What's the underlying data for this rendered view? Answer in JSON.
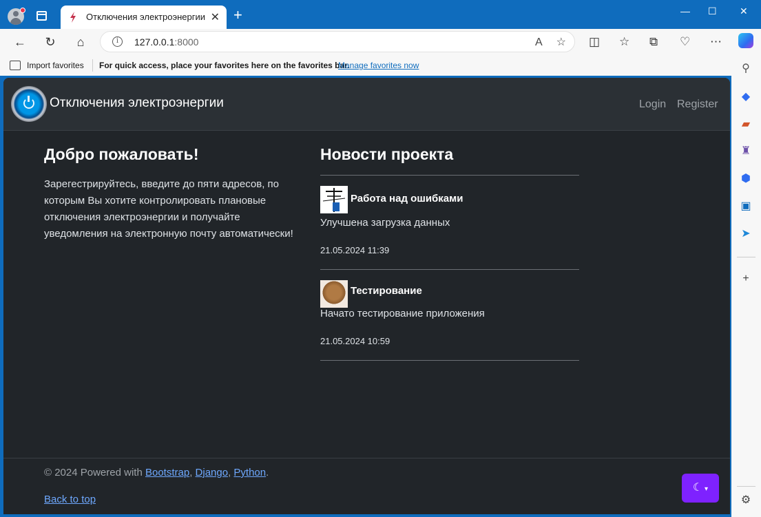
{
  "browser": {
    "tab_title": "Отключения электроэнергии",
    "tab_close": "✕",
    "new_tab": "+",
    "url_host": "127.0.0.1",
    "url_port": ":8000",
    "window_controls": {
      "minimize": "—",
      "maximize": "☐",
      "close": "✕"
    }
  },
  "favorites_bar": {
    "import_label": "Import favorites",
    "hint": "For quick access, place your favorites here on the favorites bar.",
    "manage_label": "Manage favorites now"
  },
  "site": {
    "brand": "Отключения электроэнергии",
    "nav": {
      "login": "Login",
      "register": "Register"
    },
    "welcome": {
      "title": "Добро пожаловать!",
      "text": "Зарегестрируйтесь, введите до пяти адресов, по которым Вы хотите контролировать плановые отключения электроэнергии и получайте уведомления на электронную почту автоматически!"
    },
    "news": {
      "title": "Новости проекта",
      "items": [
        {
          "headline": "Работа над ошибками",
          "body": "Улучшена загрузка данных",
          "date": "21.05.2024 11:39"
        },
        {
          "headline": "Тестирование",
          "body": "Начато тестирование приложения",
          "date": "21.05.2024 10:59"
        }
      ]
    },
    "footer": {
      "prefix": "© 2024 Powered with ",
      "links": [
        "Bootstrap",
        "Django",
        "Python"
      ],
      "back_to_top": "Back to top"
    }
  },
  "colors": {
    "browser_accent": "#0f6cbd",
    "page_bg": "#212529",
    "navbar_bg": "#2b3035",
    "link": "#6ea8fe",
    "theme_button": "#7e22ff"
  }
}
